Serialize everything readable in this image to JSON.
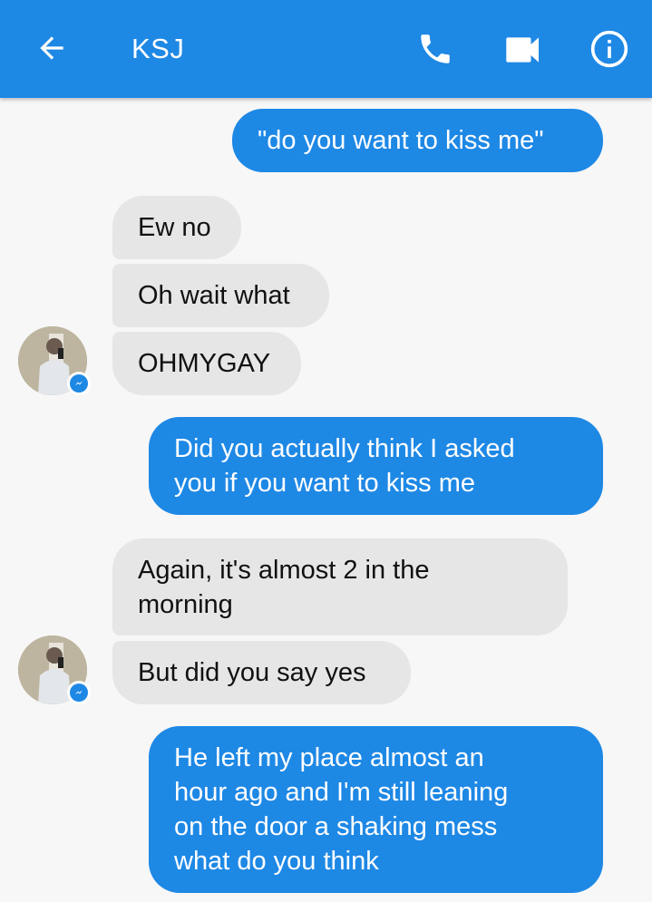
{
  "header": {
    "title": "KSJ",
    "back_icon": "arrow-back-icon",
    "actions": [
      "phone-icon",
      "video-camera-icon",
      "info-icon"
    ],
    "bar_color": "#1e88e5"
  },
  "messages": [
    {
      "from": "me",
      "text": "\"do you want to kiss me\""
    },
    {
      "from": "them",
      "text": "Ew no"
    },
    {
      "from": "them",
      "text": "Oh wait what"
    },
    {
      "from": "them",
      "text": "OHMYGAY"
    },
    {
      "from": "me",
      "text": "Did you actually think I asked\nyou if you want to kiss me"
    },
    {
      "from": "them",
      "text": "Again, it's almost 2 in the\nmorning"
    },
    {
      "from": "them",
      "text": "But did you say yes"
    },
    {
      "from": "me",
      "text": "He left my place almost an\nhour ago and I'm still leaning\non the door a shaking mess\nwhat do you think"
    }
  ],
  "colors": {
    "outgoing_bubble": "#1e88e5",
    "incoming_bubble": "#e6e6e6",
    "background": "#f7f7f7"
  }
}
